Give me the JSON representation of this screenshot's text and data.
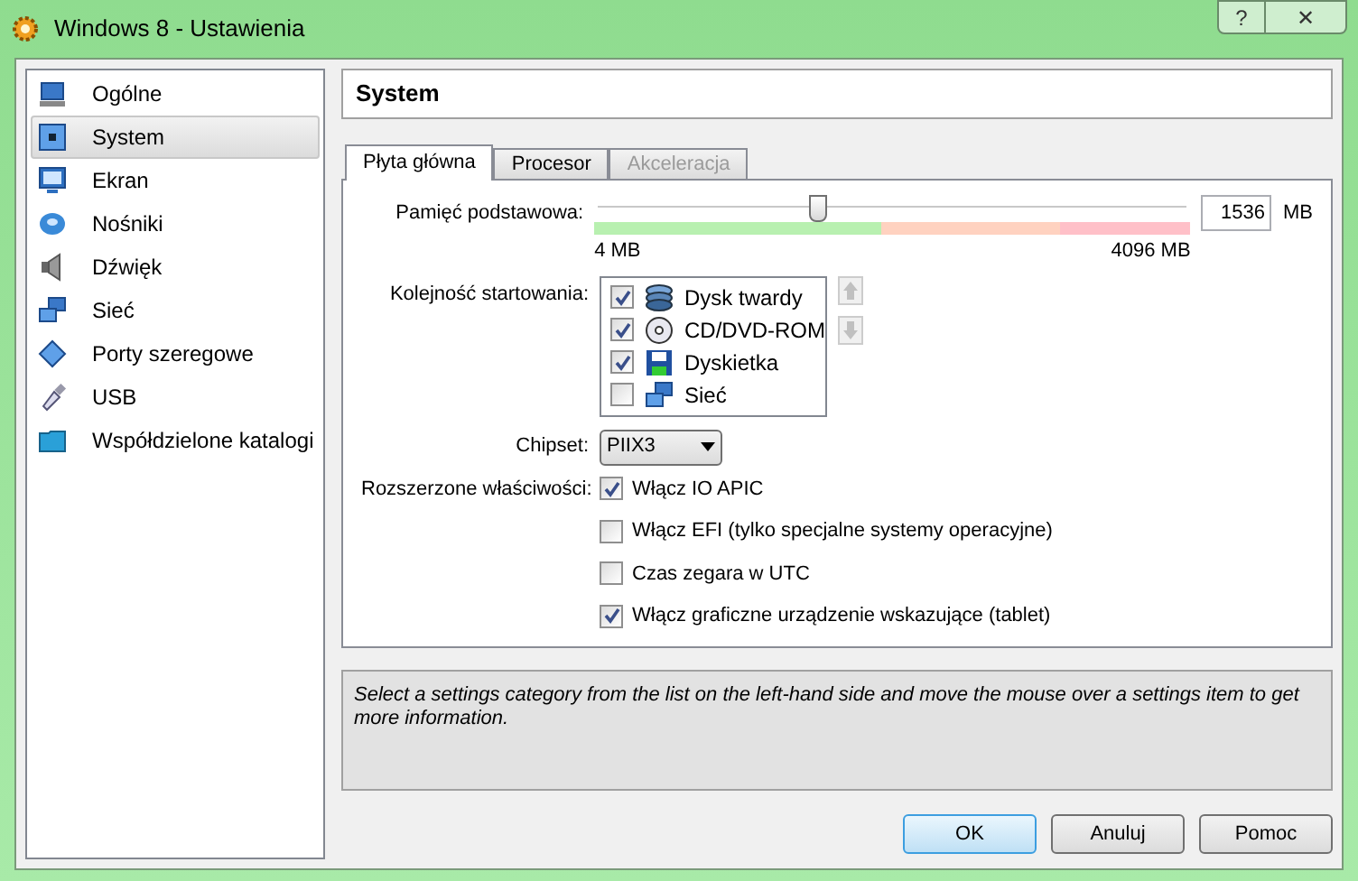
{
  "window": {
    "title": "Windows 8  - Ustawienia",
    "controls": [
      "?",
      "✕"
    ]
  },
  "sidebar": {
    "items": [
      {
        "label": "Ogólne",
        "selected": false
      },
      {
        "label": "System",
        "selected": true
      },
      {
        "label": "Ekran",
        "selected": false
      },
      {
        "label": "Nośniki",
        "selected": false
      },
      {
        "label": "Dźwięk",
        "selected": false
      },
      {
        "label": "Sieć",
        "selected": false
      },
      {
        "label": "Porty szeregowe",
        "selected": false
      },
      {
        "label": "USB",
        "selected": false
      },
      {
        "label": "Współdzielone katalogi",
        "selected": false
      }
    ]
  },
  "header": "System",
  "tabs": [
    {
      "label": "Płyta główna",
      "selected": true,
      "disabled": false
    },
    {
      "label": "Procesor",
      "selected": false,
      "disabled": false
    },
    {
      "label": "Akceleracja",
      "selected": false,
      "disabled": true
    }
  ],
  "memory": {
    "label": "Pamięć podstawowa:",
    "level": 0.375,
    "min": "4 MB",
    "max": "4096 MB",
    "value": "1536",
    "unit": "MB"
  },
  "boot_order": {
    "label": "Kolejność startowania:",
    "items": [
      {
        "label": "Dysk twardy",
        "checked": true
      },
      {
        "label": "CD/DVD-ROM",
        "checked": true
      },
      {
        "label": "Dyskietka",
        "checked": true
      },
      {
        "label": "Sieć",
        "checked": false
      }
    ]
  },
  "chipset": {
    "label": "Chipset:",
    "value": "PIIX3"
  },
  "extended": {
    "label": "Rozszerzone właściwości:",
    "options": [
      {
        "label": "Włącz IO APIC",
        "checked": true
      },
      {
        "label": "Włącz EFI (tylko specjalne systemy operacyjne)",
        "checked": false
      },
      {
        "label": "Czas zegara w UTC",
        "checked": false
      },
      {
        "label": "Włącz graficzne urządzenie wskazujące (tablet)",
        "checked": true
      }
    ]
  },
  "info": "Select a settings category from the list on the left-hand side and move the mouse over a settings item to get more information.",
  "buttons": [
    "OK",
    "Anuluj",
    "Pomoc"
  ]
}
